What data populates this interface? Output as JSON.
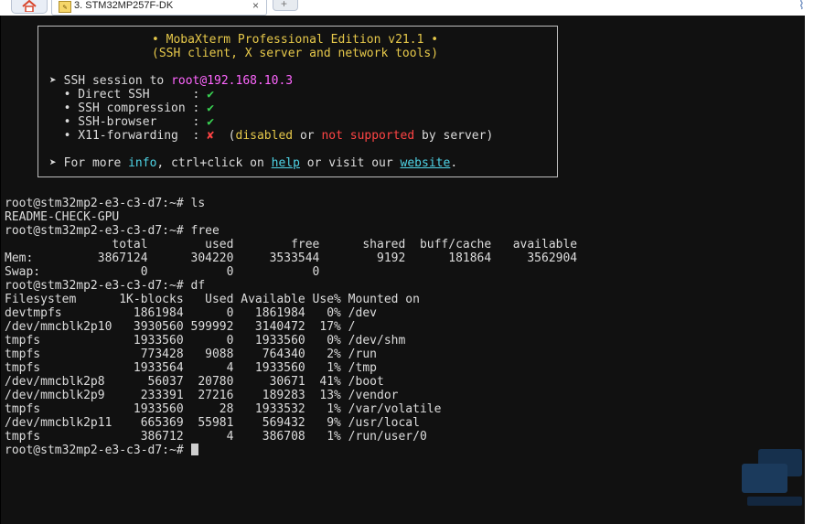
{
  "tabs": {
    "session_title": "3. STM32MP257F-DK",
    "close_glyph": "×",
    "session_icon_glyph": "✎",
    "newtab_glyph": "+"
  },
  "welcome": {
    "edition": "• MobaXterm Professional Edition v21.1 •",
    "tagline": "(SSH client, X server and network tools)",
    "ssh_prefix": "➤ SSH session to ",
    "ssh_host": "root@192.168.10.3",
    "features": [
      {
        "label": "  • Direct SSH      : ",
        "mark": "✔",
        "mark_color": "green"
      },
      {
        "label": "  • SSH compression : ",
        "mark": "✔",
        "mark_color": "green"
      },
      {
        "label": "  • SSH-browser     : ",
        "mark": "✔",
        "mark_color": "green"
      },
      {
        "label": "  • X11-forwarding  : ",
        "mark": "✘",
        "mark_color": "red"
      }
    ],
    "x11_note": {
      "open": "  (",
      "disabled": "disabled",
      "or": " or ",
      "not_supported": "not supported",
      "by_server": " by server)"
    },
    "more": {
      "prefix": "➤ For more ",
      "info": "info",
      "mid": ", ctrl+click on ",
      "help": "help",
      "mid2": " or visit our ",
      "website": "website",
      "end": "."
    }
  },
  "terminal_lines": [
    "root@stm32mp2-e3-c3-d7:~# ls",
    "README-CHECK-GPU",
    "root@stm32mp2-e3-c3-d7:~# free",
    "               total        used        free      shared  buff/cache   available",
    "Mem:         3867124      304220     3533544        9192      181864     3562904",
    "Swap:              0           0           0",
    "root@stm32mp2-e3-c3-d7:~# df",
    "Filesystem      1K-blocks   Used Available Use% Mounted on",
    "devtmpfs          1861984      0   1861984   0% /dev",
    "/dev/mmcblk2p10   3930560 599992   3140472  17% /",
    "tmpfs             1933560      0   1933560   0% /dev/shm",
    "tmpfs              773428   9088    764340   2% /run",
    "tmpfs             1933564      4   1933560   1% /tmp",
    "/dev/mmcblk2p8      56037  20780     30671  41% /boot",
    "/dev/mmcblk2p9     233391  27216    189283  13% /vendor",
    "tmpfs             1933560     28   1933532   1% /var/volatile",
    "/dev/mmcblk2p11    665369  55981    569432   9% /usr/local",
    "tmpfs              386712      4    386708   1% /run/user/0"
  ],
  "prompt": "root@stm32mp2-e3-c3-d7:~# ",
  "colors": {
    "terminal_bg": "#111111",
    "text": "#dcdcdc",
    "green": "#39d353",
    "yellow": "#e6c84a",
    "magenta": "#ff66ff",
    "cyan": "#4fd4e6",
    "red": "#ff4444"
  },
  "icons": [
    "home-icon",
    "session-icon",
    "close-icon",
    "new-tab-icon",
    "attach-icon",
    "watermark-logo-icon"
  ]
}
